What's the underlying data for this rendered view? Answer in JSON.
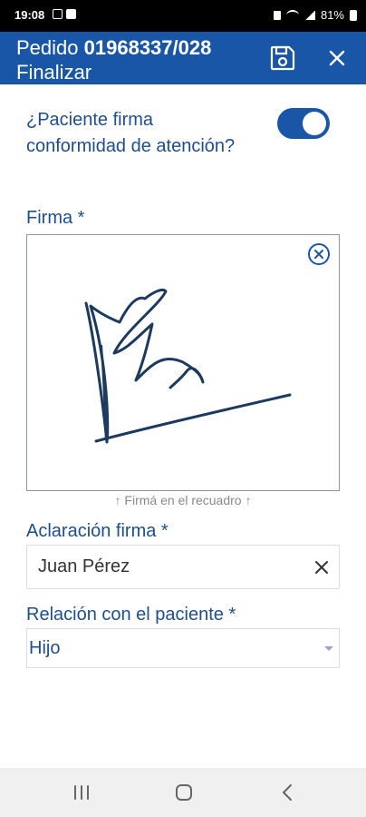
{
  "status_bar": {
    "time": "19:08",
    "battery": "81%"
  },
  "app_bar": {
    "title_prefix": "Pedido",
    "order_number": "01968337/028",
    "subtitle": "Finalizar",
    "color": "#1a56a8"
  },
  "form": {
    "consent_question": "¿Paciente firma conformidad de atención?",
    "consent_toggle": true,
    "signature_label": "Firma *",
    "signature_hint": "↑ Firmá en el recuadro ↑",
    "name_label": "Aclaración firma *",
    "name_value": "Juan Pérez",
    "relation_label": "Relación con el paciente *",
    "relation_value": "Hijo"
  },
  "icons": {
    "save": "save-icon",
    "close": "close-icon",
    "clear_signature": "circle-x-icon",
    "clear_field": "x-icon",
    "dropdown": "caret-down-icon"
  }
}
